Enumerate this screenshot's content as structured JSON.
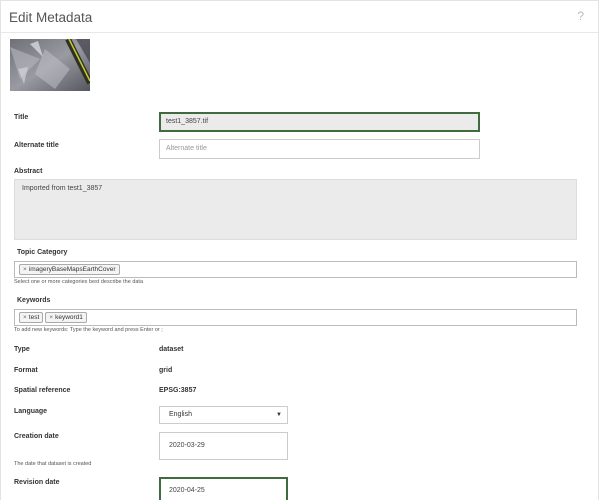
{
  "header": {
    "title": "Edit Metadata",
    "help": "?"
  },
  "fields": {
    "title": {
      "label": "Title",
      "value": "test1_3857.tif"
    },
    "alternate_title": {
      "label": "Alternate title",
      "placeholder": "Alternate title"
    },
    "abstract": {
      "label": "Abstract",
      "value": "Imported from test1_3857"
    },
    "topic_category": {
      "label": "Topic Category",
      "tags": [
        {
          "remove": "×",
          "label": "imageryBaseMapsEarthCover"
        }
      ],
      "hint": "Select one or more categories best describe the data"
    },
    "keywords": {
      "label": "Keywords",
      "tags": [
        {
          "remove": "×",
          "label": "test"
        },
        {
          "remove": "×",
          "label": "keyword1"
        }
      ],
      "hint": "To add new keywords: Type the keyword and press Enter or ;"
    },
    "type": {
      "label": "Type",
      "value": "dataset"
    },
    "format": {
      "label": "Format",
      "value": "grid"
    },
    "spatial_reference": {
      "label": "Spatial reference",
      "value": "EPSG:3857"
    },
    "language": {
      "label": "Language",
      "value": "English",
      "caret": "▼"
    },
    "creation_date": {
      "label": "Creation date",
      "value": "2020-03-29",
      "hint": "The date that dataset is created"
    },
    "revision_date": {
      "label": "Revision date",
      "value": "2020-04-25"
    }
  },
  "colors": {
    "focus_border": "#3f6b3f",
    "readonly_bg": "#ebebeb"
  }
}
